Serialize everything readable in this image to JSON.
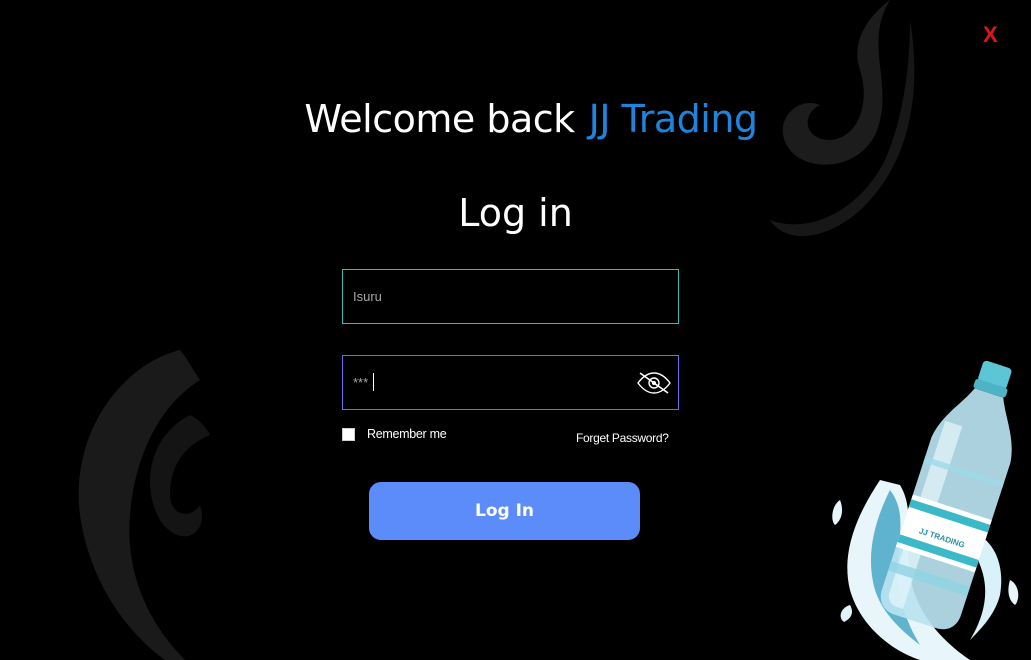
{
  "window": {
    "close_label": "X"
  },
  "welcome": {
    "text": "Welcome back",
    "brand": "JJ Trading"
  },
  "title": "Log in",
  "username": {
    "value": "Isuru",
    "placeholder": ""
  },
  "password": {
    "masked_value": "***",
    "toggle_icon": "eye-slash-icon"
  },
  "remember": {
    "label": "Remember me",
    "checked": false
  },
  "forget_password": "Forget Password?",
  "login_button": "Log In",
  "bottle_label": "JJ TRADING",
  "colors": {
    "background": "#000000",
    "brand": "#1e84dc",
    "close": "#e0141e",
    "button": "#5c8cfa",
    "username_border": "#2fbfb0",
    "password_border": "#6b6bf0"
  }
}
